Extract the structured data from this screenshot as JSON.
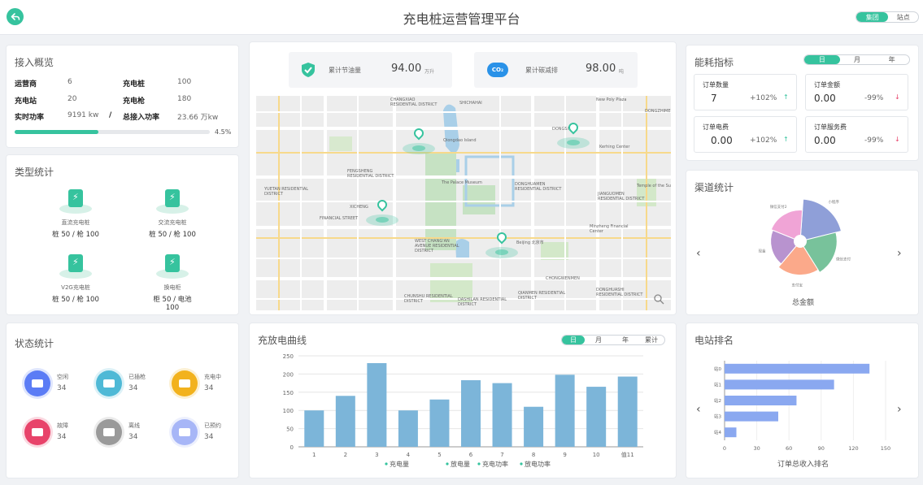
{
  "app_title": "充电桩运营管理平台",
  "header": {
    "scope_options": [
      "集团",
      "站点"
    ],
    "scope_selected": 0
  },
  "colors": {
    "accent": "#36c39e",
    "bar": "#7cb5d9",
    "rank_bar": "#8aa8f0"
  },
  "overview": {
    "title": "接入概览",
    "rows": [
      {
        "l1": "运营商",
        "v1": "6",
        "l2": "充电桩",
        "v2": "100"
      },
      {
        "l1": "充电站",
        "v1": "20",
        "l2": "充电枪",
        "v2": "180"
      },
      {
        "l1": "实时功率",
        "v1": "9191 kw",
        "l2": "总接入功率",
        "v2": "23.66 万kw"
      }
    ],
    "separator": "/",
    "progress_percent": 4.5,
    "progress_label": "4.5%"
  },
  "types": {
    "title": "类型统计",
    "items": [
      {
        "name": "直流充电桩",
        "value": "桩 50 / 枪 100",
        "icon": "charger-icon"
      },
      {
        "name": "交流充电桩",
        "value": "桩 50 / 枪 100",
        "icon": "charger-icon"
      },
      {
        "name": "V2G充电桩",
        "value": "桩 50 / 枪 100",
        "icon": "charger-icon"
      },
      {
        "name": "换电柜",
        "value": "柜 50 / 电池 100",
        "icon": "battery-swap-icon"
      }
    ]
  },
  "status": {
    "title": "状态统计",
    "items": [
      {
        "name": "空闲",
        "value": "34",
        "color": "#5b7cf5"
      },
      {
        "name": "已插枪",
        "value": "34",
        "color": "#4fb9d6"
      },
      {
        "name": "充电中",
        "value": "34",
        "color": "#f2b21d"
      },
      {
        "name": "故障",
        "value": "34",
        "color": "#e8436a"
      },
      {
        "name": "离线",
        "value": "34",
        "color": "#9a9a9a"
      },
      {
        "name": "已预约",
        "value": "34",
        "color": "#a7b6f7"
      }
    ]
  },
  "savings": [
    {
      "label": "累计节油量",
      "value": "94.00",
      "unit": "万升",
      "icon": "shield-check-icon"
    },
    {
      "label": "累计碳减排",
      "value": "98.00",
      "unit": "吨",
      "icon": "co2-cloud-icon",
      "icon_text": "CO₂"
    }
  ],
  "map": {
    "markers": 4,
    "labels": [
      "CHANGXIAO RESIDENTIAL DISTRICT",
      "SHICHAHAI",
      "New Poly Plaza",
      "DONGSI",
      "DONGZHIMEN",
      "FENGSHENG RESIDENTIAL DISTRICT",
      "Qiongdao Island",
      "The Palace Museum",
      "Kerhing Center",
      "JIANGUOMEN RESIDENTIAL DISTRICT",
      "XICHENG",
      "FINANCIAL STREET",
      "Beijing 北京市",
      "WEST CHANG'AN AVENUE RESIDENTIAL DISTRICT",
      "CHONGWENMEN",
      "DONGHUASHI RESIDENTIAL DISTRICT",
      "CHUNSHU RESIDENTIAL DISTRICT",
      "DASHILAN RESIDENTIAL DISTRICT",
      "QIANMEN RESIDENTIAL DISTRICT",
      "Minzheng Financial Center",
      "Temple of the Sun",
      "YUETAN RESIDENTIAL DISTRICT",
      "DONGHUAMEN RESIDENTIAL DISTRICT"
    ]
  },
  "energy": {
    "title": "能耗指标",
    "tabs": [
      "日",
      "月",
      "年"
    ],
    "tab_selected": 0,
    "cards": [
      {
        "label": "订单数量",
        "value": "7",
        "delta": "+102%",
        "trend": "up"
      },
      {
        "label": "订单金额",
        "value": "0.00",
        "delta": "-99%",
        "trend": "down"
      },
      {
        "label": "订单电费",
        "value": "0.00",
        "delta": "+102%",
        "trend": "up"
      },
      {
        "label": "订单服务费",
        "value": "0.00",
        "delta": "-99%",
        "trend": "down"
      }
    ]
  },
  "channel": {
    "title": "渠道统计",
    "caption": "总金额",
    "prev": "‹",
    "next": "›",
    "slices": [
      {
        "label": "小程序",
        "value": 1.0,
        "radius": 1.0,
        "color": "#8f9fd8"
      },
      {
        "label": "微信支付",
        "value": 1.0,
        "radius": 0.87,
        "color": "#78c29b"
      },
      {
        "label": "支付宝",
        "value": 1.0,
        "radius": 0.8,
        "color": "#fba98a"
      },
      {
        "label": "现金",
        "value": 1.0,
        "radius": 0.7,
        "color": "#b893cf"
      },
      {
        "label": "微信支付2",
        "value": 1.0,
        "radius": 0.74,
        "color": "#f0a4d6"
      }
    ]
  },
  "chart_data": [
    {
      "type": "bar",
      "title": "充放电曲线",
      "tabs": [
        "日",
        "月",
        "年",
        "累计"
      ],
      "tab_selected": 0,
      "categories": [
        "1",
        "2",
        "3",
        "4",
        "5",
        "6",
        "7",
        "8",
        "9",
        "10",
        "值11"
      ],
      "series": [
        {
          "name": "充电量",
          "values": [
            100,
            140,
            230,
            100,
            130,
            183,
            175,
            110,
            198,
            165,
            193
          ]
        }
      ],
      "legend": [
        "充电量",
        "放电量",
        "充电功率",
        "放电功率"
      ],
      "ylim": [
        0,
        250
      ],
      "yticks": [
        0,
        50,
        100,
        150,
        200,
        250
      ],
      "grid": true,
      "legend_position": "bottom"
    },
    {
      "type": "bar",
      "orientation": "horizontal",
      "title": "电站排名",
      "categories": [
        "站0",
        "站1",
        "站2",
        "站3",
        "站4"
      ],
      "values": [
        135,
        102,
        67,
        50,
        11
      ],
      "xlim": [
        0,
        150
      ],
      "xticks": [
        0,
        30,
        60,
        90,
        120,
        150
      ],
      "xlabel": "订单总收入排名"
    }
  ]
}
